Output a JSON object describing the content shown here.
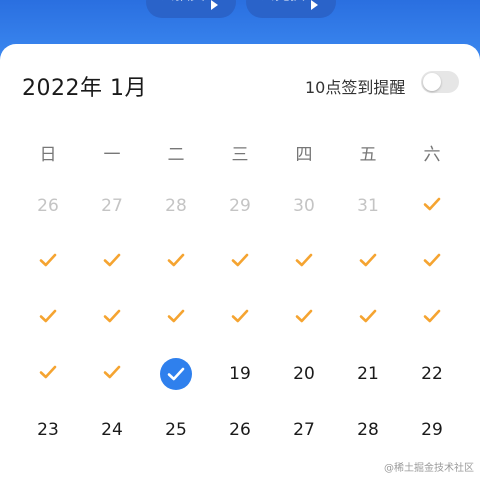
{
  "top_buttons": {
    "lottery_label": "去抽奖",
    "exchange_label": "去兑换"
  },
  "header": {
    "month_title": "2022年 1月",
    "reminder_label": "10点签到提醒",
    "reminder_enabled": false
  },
  "weekdays": [
    "日",
    "一",
    "二",
    "三",
    "四",
    "五",
    "六"
  ],
  "calendar": {
    "rows": [
      [
        {
          "label": "26",
          "state": "prev"
        },
        {
          "label": "27",
          "state": "prev"
        },
        {
          "label": "28",
          "state": "prev"
        },
        {
          "label": "29",
          "state": "prev"
        },
        {
          "label": "30",
          "state": "prev"
        },
        {
          "label": "31",
          "state": "prev"
        },
        {
          "label": "",
          "state": "checked"
        }
      ],
      [
        {
          "label": "",
          "state": "checked"
        },
        {
          "label": "",
          "state": "checked"
        },
        {
          "label": "",
          "state": "checked"
        },
        {
          "label": "",
          "state": "checked"
        },
        {
          "label": "",
          "state": "checked"
        },
        {
          "label": "",
          "state": "checked"
        },
        {
          "label": "",
          "state": "checked"
        }
      ],
      [
        {
          "label": "",
          "state": "checked"
        },
        {
          "label": "",
          "state": "checked"
        },
        {
          "label": "",
          "state": "checked"
        },
        {
          "label": "",
          "state": "checked"
        },
        {
          "label": "",
          "state": "checked"
        },
        {
          "label": "",
          "state": "checked"
        },
        {
          "label": "",
          "state": "checked"
        }
      ],
      [
        {
          "label": "",
          "state": "checked"
        },
        {
          "label": "",
          "state": "checked"
        },
        {
          "label": "",
          "state": "today"
        },
        {
          "label": "19",
          "state": "current"
        },
        {
          "label": "20",
          "state": "current"
        },
        {
          "label": "21",
          "state": "current"
        },
        {
          "label": "22",
          "state": "current"
        }
      ],
      [
        {
          "label": "23",
          "state": "current"
        },
        {
          "label": "24",
          "state": "current"
        },
        {
          "label": "25",
          "state": "current"
        },
        {
          "label": "26",
          "state": "current"
        },
        {
          "label": "27",
          "state": "current"
        },
        {
          "label": "28",
          "state": "current"
        },
        {
          "label": "29",
          "state": "current"
        }
      ]
    ]
  },
  "icons": {
    "check": "check-icon",
    "today_check": "check-circle-icon",
    "arrow": "triangle-right-icon"
  },
  "colors": {
    "accent_blue": "#2f80ed",
    "check_orange": "#f5a431",
    "prev_month_gray": "#c4c4c4"
  },
  "watermark": "@稀土掘金技术社区"
}
